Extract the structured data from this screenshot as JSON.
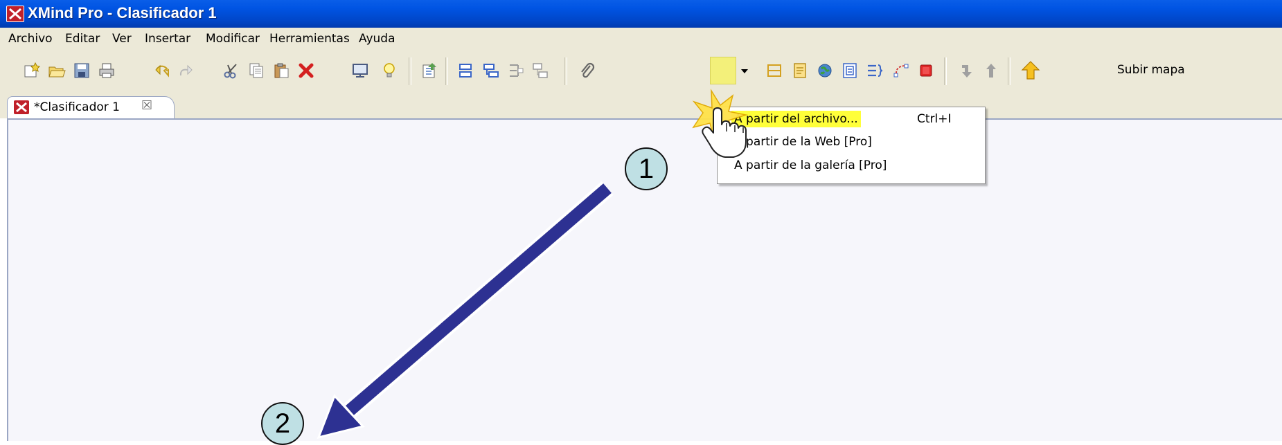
{
  "window": {
    "title": "XMind Pro - Clasificador 1"
  },
  "menu": [
    "Archivo",
    "Editar",
    "Ver",
    "Insertar",
    "Modificar",
    "Herramientas",
    "Ayuda"
  ],
  "toolbar": {
    "icons": [
      "new-map-icon",
      "open-icon",
      "save-icon",
      "print-icon",
      "undo-icon",
      "redo-icon",
      "cut-icon",
      "copy-icon",
      "paste-icon",
      "delete-icon",
      "presentation-icon",
      "idea-icon",
      "export-icon",
      "insert-topic-icon",
      "insert-subtopic-icon",
      "callout-icon",
      "floating-topic-icon",
      "attachment-icon",
      "image-icon",
      "dropdown-arrow-icon",
      "boundary-icon",
      "note-icon",
      "hyperlink-icon",
      "label-icon",
      "summary-icon",
      "relationship-icon",
      "marker-icon",
      "drill-down-icon",
      "drill-up-icon",
      "upload-map-icon"
    ],
    "subir_mapa": "Subir mapa"
  },
  "tab": {
    "label": "*Clasificador 1",
    "close_glyph": "☒"
  },
  "dropdown": {
    "items": [
      {
        "label": "A partir del archivo...",
        "shortcut": "Ctrl+I"
      },
      {
        "label": "A partir de la Web [Pro]"
      },
      {
        "label": "A partir de la galería [Pro]"
      }
    ]
  },
  "annotations": {
    "step1": "1",
    "step2": "2"
  },
  "colors": {
    "titlebar": "#0054e3",
    "menubar": "#ece9d8",
    "highlight": "#ffff3a",
    "arrow": "#2d3192",
    "circle_fill": "#bfe0e4"
  }
}
